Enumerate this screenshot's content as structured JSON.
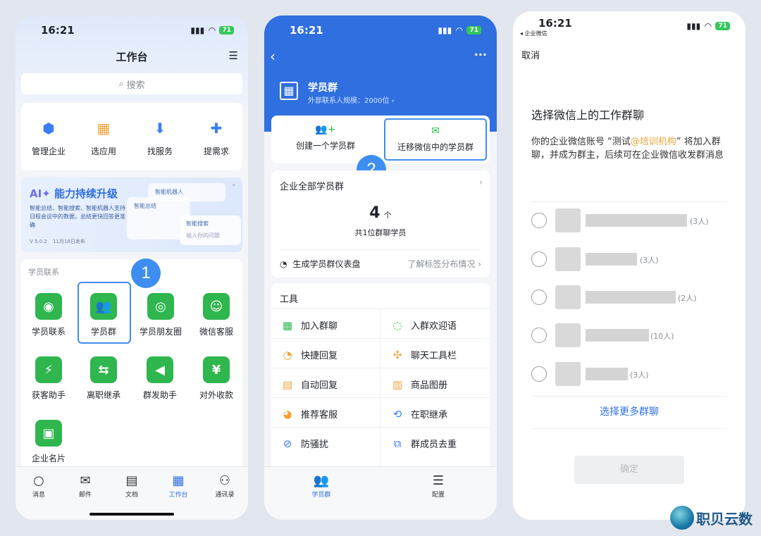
{
  "p1": {
    "time": "16:21",
    "battery": "71",
    "title": "工作台",
    "search_placeholder": "搜索",
    "quick": [
      {
        "label": "管理企业",
        "icon": "⬢",
        "color": "#3a7df6"
      },
      {
        "label": "选应用",
        "icon": "▦",
        "color": "#f0a43a"
      },
      {
        "label": "找服务",
        "icon": "⬇",
        "color": "#3a7df6"
      },
      {
        "label": "提需求",
        "icon": "✚",
        "color": "#3a7df6"
      }
    ],
    "banner": {
      "title_ai": "AI✦",
      "title": "能力持续升级",
      "desc": "智能总结、智能搜索、智能机器人支持日程会议中的数据，总结更快回答更准确",
      "version": "V 5.0.2",
      "date": "11月18日发布",
      "card1": "智能总结",
      "card2": "智能机器人",
      "card3": "智能搜索",
      "card3_sub": "输入你的问题"
    },
    "section": "学员联系",
    "apps": [
      {
        "label": "学员联系",
        "icon": "◉"
      },
      {
        "label": "学员群",
        "icon": "👥"
      },
      {
        "label": "学员朋友圈",
        "icon": "◎"
      },
      {
        "label": "微信客服",
        "icon": "☺"
      },
      {
        "label": "获客助手",
        "icon": "⚡"
      },
      {
        "label": "离职继承",
        "icon": "⇆"
      },
      {
        "label": "群发助手",
        "icon": "◀"
      },
      {
        "label": "对外收款",
        "icon": "¥"
      },
      {
        "label": "企业名片",
        "icon": "▣"
      }
    ],
    "step": "1",
    "tabs": [
      {
        "label": "消息",
        "icon": "○"
      },
      {
        "label": "邮件",
        "icon": "✉"
      },
      {
        "label": "文档",
        "icon": "▤"
      },
      {
        "label": "工作台",
        "icon": "▦"
      },
      {
        "label": "通讯录",
        "icon": "⚇"
      }
    ]
  },
  "p2": {
    "time": "16:21",
    "battery": "71",
    "group_title": "学员群",
    "group_sub": "外部联系人规模：2000位 ›",
    "create_label": "创建一个学员群",
    "migrate_label": "迁移微信中的学员群",
    "step": "2",
    "all_groups": "企业全部学员群",
    "count": "4",
    "count_unit": "个",
    "count_desc": "共1位群聊学员",
    "dashboard": "生成学员群仪表盘",
    "dashboard_link": "了解标签分布情况",
    "tools_title": "工具",
    "tools": [
      {
        "label": "加入群聊",
        "icon": "▦",
        "color": "#2fb64e"
      },
      {
        "label": "入群欢迎语",
        "icon": "◌",
        "color": "#2fb64e"
      },
      {
        "label": "快捷回复",
        "icon": "◔",
        "color": "#f0a43a"
      },
      {
        "label": "聊天工具栏",
        "icon": "✣",
        "color": "#f0a43a"
      },
      {
        "label": "自动回复",
        "icon": "▤",
        "color": "#f0a43a"
      },
      {
        "label": "商品图册",
        "icon": "▥",
        "color": "#f0a43a"
      },
      {
        "label": "推荐客服",
        "icon": "◕",
        "color": "#f0a43a"
      },
      {
        "label": "在职继承",
        "icon": "⟲",
        "color": "#3a7df6"
      },
      {
        "label": "防骚扰",
        "icon": "⊘",
        "color": "#3a7df6"
      },
      {
        "label": "群成员去重",
        "icon": "⧉",
        "color": "#3a7df6"
      }
    ],
    "tabs": [
      {
        "label": "学员群",
        "icon": "👥"
      },
      {
        "label": "配置",
        "icon": "☰"
      }
    ]
  },
  "p3": {
    "time": "16:21",
    "back_app": "◂ 企业微信",
    "battery": "71",
    "cancel": "取消",
    "heading": "选择微信上的工作群聊",
    "desc_pre": "你的企业微信账号 “测试",
    "desc_org": "@培训机构",
    "desc_post": "” 将加入群聊，并成为群主，后续可在企业微信收发群消息",
    "groups": [
      {
        "count": "(3人)"
      },
      {
        "count": "(3人)"
      },
      {
        "count": "(2人)"
      },
      {
        "count": "(10人)"
      },
      {
        "count": "(3人)"
      }
    ],
    "more": "选择更多群聊",
    "confirm": "确定"
  },
  "watermark": "职贝云数"
}
